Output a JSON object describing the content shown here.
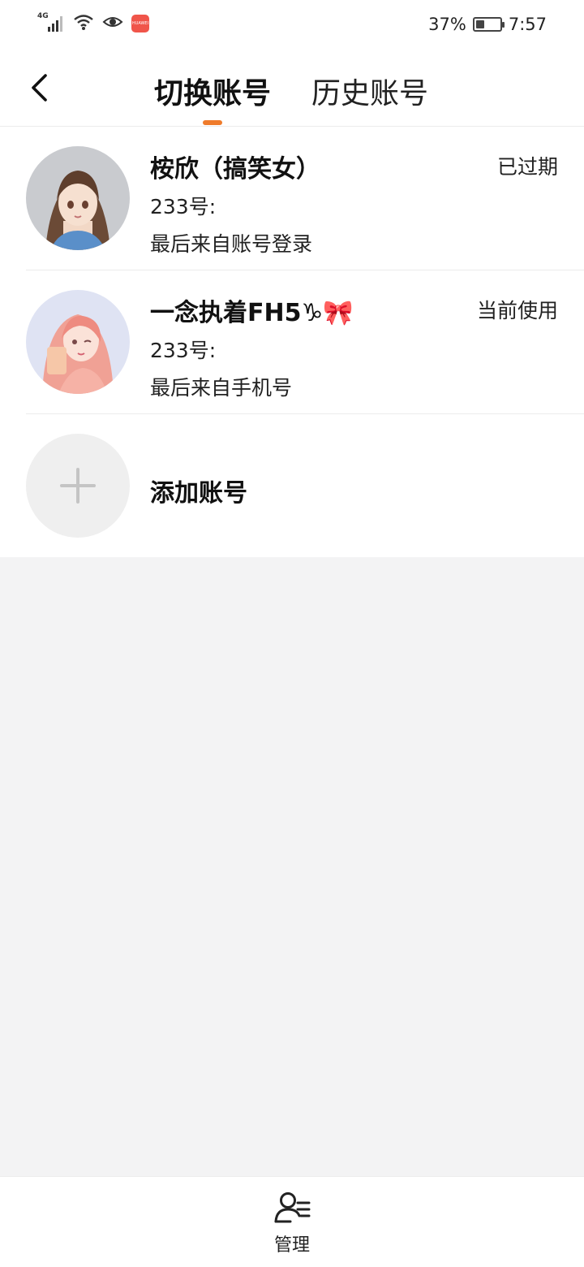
{
  "status_bar": {
    "network": "4G",
    "battery_percent": "37%",
    "battery_level": 0.37,
    "time": "7:57",
    "app_badge_text": "HUAWEI"
  },
  "header": {
    "tabs": [
      {
        "label": "切换账号",
        "active": true
      },
      {
        "label": "历史账号",
        "active": false
      }
    ],
    "accent_color": "#ef7b2b"
  },
  "accounts": [
    {
      "name": "桉欣（搞笑女）",
      "uid": "233号:",
      "login_source": "最后来自账号登录",
      "status": "已过期"
    },
    {
      "name": "一念执着FH5♑🎀",
      "uid": "233号:",
      "login_source": "最后来自手机号",
      "status": "当前使用"
    }
  ],
  "add_account": {
    "label": "添加账号"
  },
  "bottom": {
    "manage_label": "管理"
  }
}
